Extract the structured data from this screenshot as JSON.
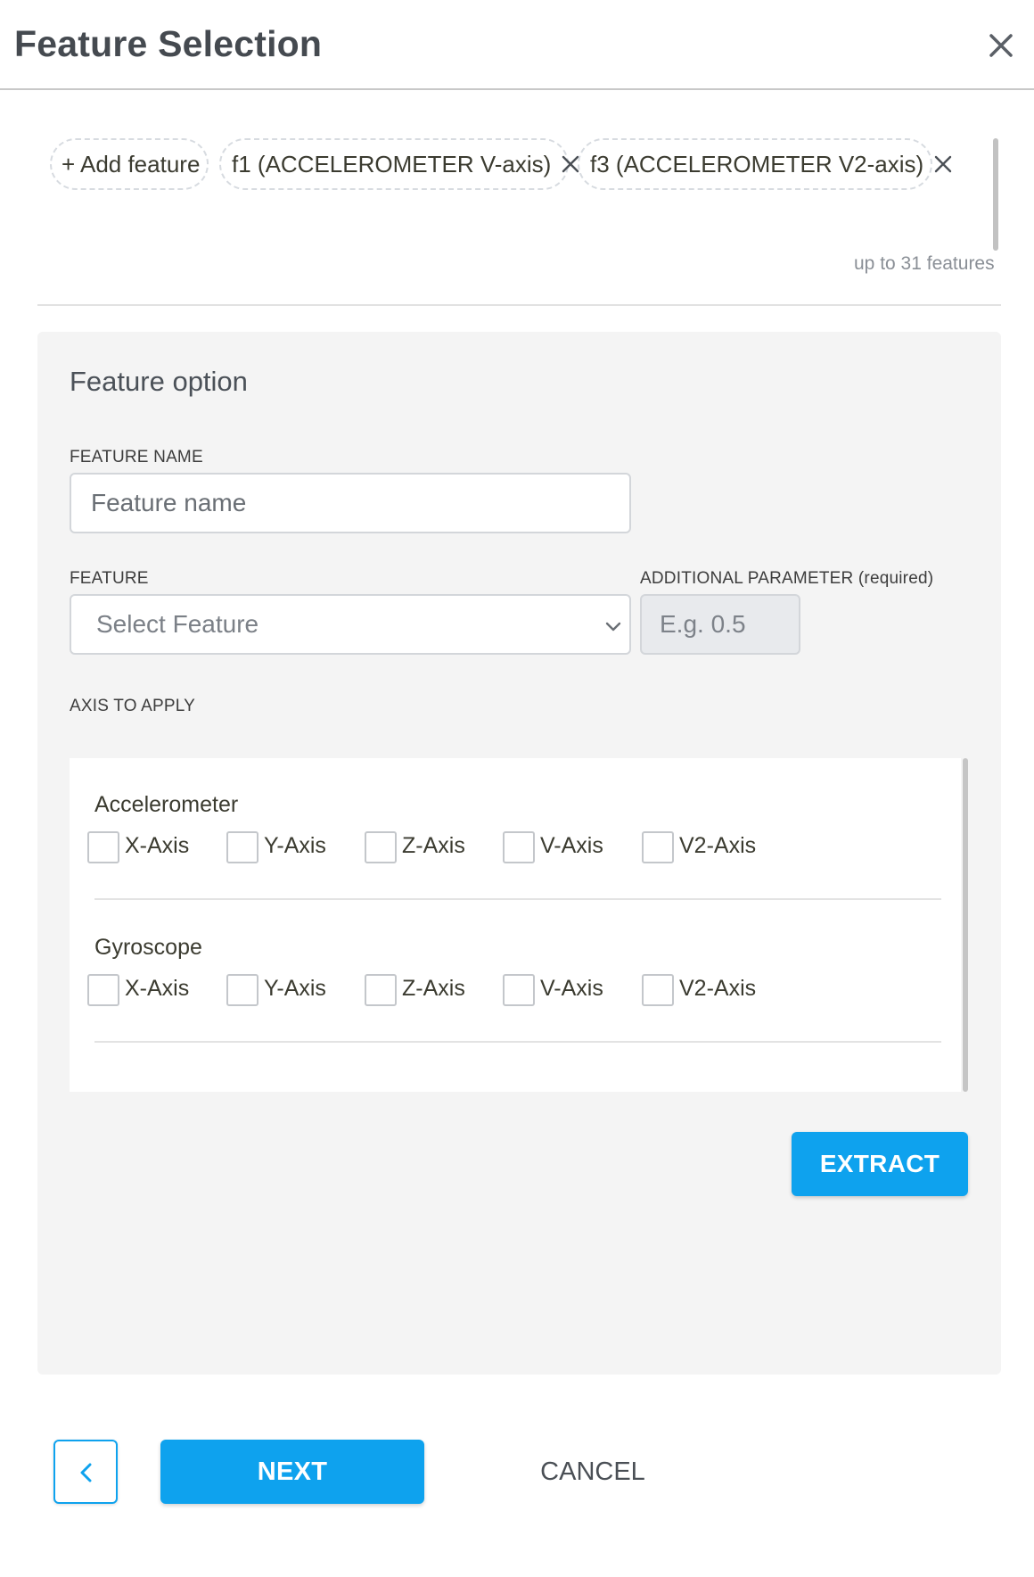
{
  "header": {
    "title": "Feature Selection",
    "close_icon": "close-icon"
  },
  "chips": {
    "add_label": "+ Add feature",
    "items": [
      {
        "label": "f1 (ACCELEROMETER V-axis)"
      },
      {
        "label": "f3 (ACCELEROMETER V2-axis)"
      }
    ],
    "limit_note": "up to 31 features"
  },
  "panel": {
    "title": "Feature option",
    "feature_name": {
      "label": "FEATURE NAME",
      "placeholder": "Feature name",
      "value": ""
    },
    "feature": {
      "label": "FEATURE",
      "selected": "Select Feature"
    },
    "param": {
      "label": "ADDITIONAL PARAMETER (required)",
      "placeholder": "E.g. 0.5",
      "value": ""
    },
    "axis_label": "AXIS TO APPLY",
    "sensors": [
      {
        "name": "Accelerometer",
        "axes": [
          "X-Axis",
          "Y-Axis",
          "Z-Axis",
          "V-Axis",
          "V2-Axis"
        ]
      },
      {
        "name": "Gyroscope",
        "axes": [
          "X-Axis",
          "Y-Axis",
          "Z-Axis",
          "V-Axis",
          "V2-Axis"
        ]
      }
    ],
    "extract_label": "EXTRACT"
  },
  "footer": {
    "back_icon": "chevron-left-icon",
    "next_label": "NEXT",
    "cancel_label": "CANCEL"
  },
  "colors": {
    "accent": "#0ea2ee",
    "panel_bg": "#f4f4f4",
    "title": "#454a50"
  }
}
